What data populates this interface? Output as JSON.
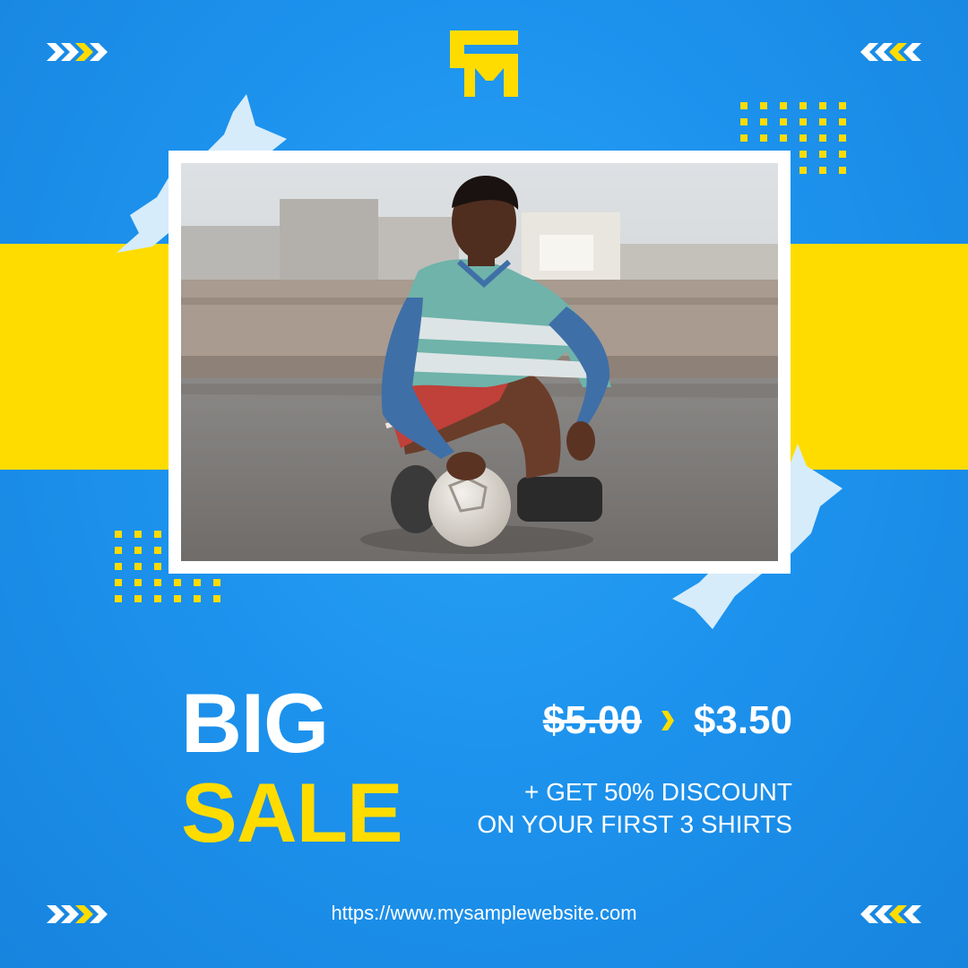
{
  "brand": {
    "logo": "fm-logo",
    "accent_color": "#ffdc00",
    "background_color": "#1d93ee"
  },
  "photo": {
    "alt": "Boy crouching on a worn soccer ball on a street"
  },
  "headline": {
    "line1": "BIG",
    "line2": "SALE"
  },
  "pricing": {
    "old_price": "$5.00",
    "new_price": "$3.50"
  },
  "promo": {
    "line1": "+ GET 50% DISCOUNT",
    "line2": "ON YOUR FIRST 3 SHIRTS"
  },
  "footer": {
    "url": "https://www.mysamplewebsite.com"
  },
  "icons": {
    "corner": "chevron-arrows-icon",
    "pattern": "dot-grid-pattern",
    "torn": "torn-paper-shard",
    "separator": "chevron-right-icon"
  }
}
